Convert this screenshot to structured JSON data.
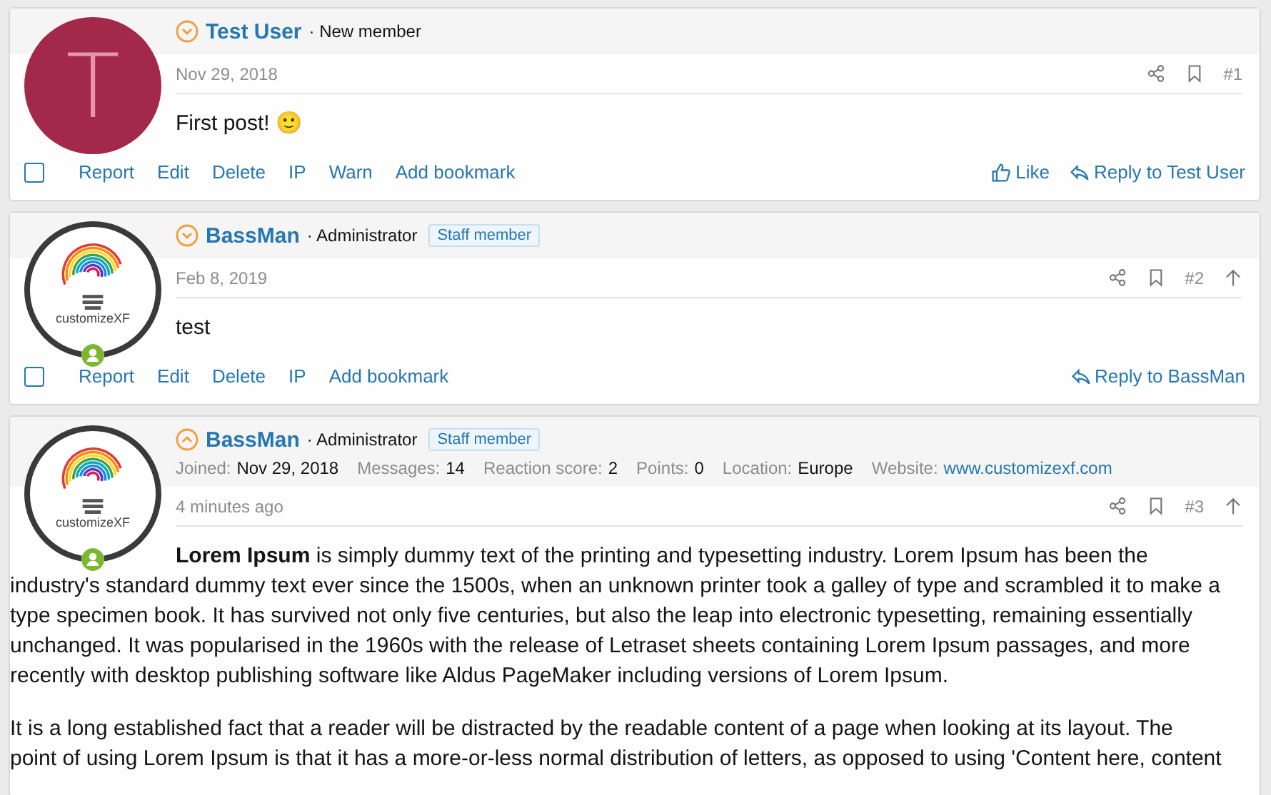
{
  "posts": [
    {
      "number": "#1",
      "author": "Test User",
      "title": "· New member",
      "expanded": false,
      "online": false,
      "avatar": {
        "kind": "letter",
        "letter": "T",
        "color": "#a3294a"
      },
      "date": "Nov 29, 2018",
      "top_arrow": false,
      "body": [
        "First post! 🙂"
      ],
      "checked": false,
      "actions": [
        "Report",
        "Edit",
        "Delete",
        "IP",
        "Warn",
        "Add bookmark"
      ],
      "like": "Like",
      "reply": "Reply to Test User"
    },
    {
      "number": "#2",
      "author": "BassMan",
      "title": "· Administrator",
      "staff_badge": "Staff member",
      "expanded": false,
      "online": true,
      "avatar": {
        "kind": "logo",
        "caption": "customizeXF"
      },
      "date": "Feb 8, 2019",
      "top_arrow": true,
      "body": [
        "test"
      ],
      "checked": false,
      "actions": [
        "Report",
        "Edit",
        "Delete",
        "IP",
        "Add bookmark"
      ],
      "reply": "Reply to BassMan"
    },
    {
      "number": "#3",
      "author": "BassMan",
      "title": "· Administrator",
      "staff_badge": "Staff member",
      "expanded": true,
      "online": true,
      "avatar": {
        "kind": "logo",
        "caption": "customizeXF"
      },
      "stats": [
        {
          "label": "Joined:",
          "value": "Nov 29, 2018",
          "kind": "text"
        },
        {
          "label": "Messages:",
          "value": "14",
          "kind": "text"
        },
        {
          "label": "Reaction score:",
          "value": "2",
          "kind": "text"
        },
        {
          "label": "Points:",
          "value": "0",
          "kind": "text"
        },
        {
          "label": "Location:",
          "value": "Europe",
          "kind": "text"
        },
        {
          "label": "Website:",
          "value": "www.customizexf.com",
          "kind": "link"
        }
      ],
      "date": "4 minutes ago",
      "top_arrow": true,
      "body": [
        "**Lorem Ipsum** is simply dummy text of the printing and typesetting industry. Lorem Ipsum has been the industry's standard dummy text ever since the 1500s, when an unknown printer took a galley of type and scrambled it to make a type specimen book. It has survived not only five centuries, but also the leap into electronic typesetting, remaining essentially unchanged. It was popularised in the 1960s with the release of Letraset sheets containing Lorem Ipsum passages, and more recently with desktop publishing software like Aldus PageMaker including versions of Lorem Ipsum.",
        "It is a long established fact that a reader will be distracted by the readable content of a page when looking at its layout. The point of using Lorem Ipsum is that it has a more-or-less normal distribution of letters, as opposed to using 'Content here, content"
      ]
    }
  ]
}
